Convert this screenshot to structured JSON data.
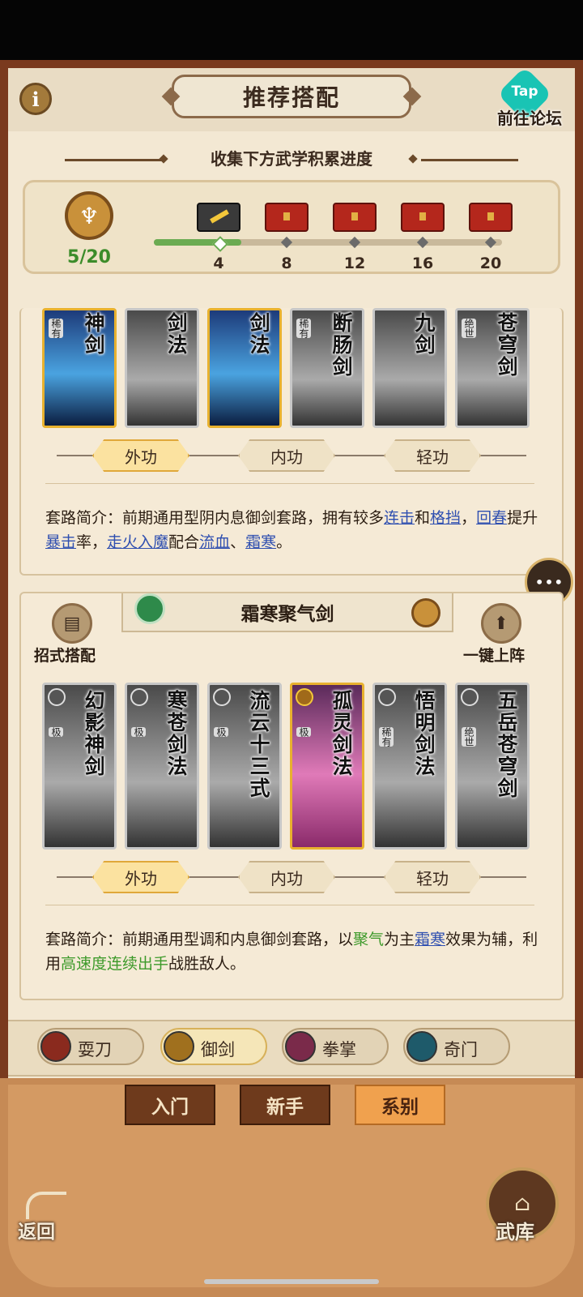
{
  "header": {
    "title": "推荐搭配",
    "info_icon": "i",
    "tap_logo": "Tap",
    "forum_label": "前往论坛"
  },
  "progress": {
    "title": "收集下方武学积累进度",
    "current": "5/20",
    "fraction": 0.25,
    "milestones": [
      {
        "value": "4",
        "state": "claimed"
      },
      {
        "value": "8",
        "state": "locked"
      },
      {
        "value": "12",
        "state": "locked"
      },
      {
        "value": "16",
        "state": "locked"
      },
      {
        "value": "20",
        "state": "locked"
      }
    ]
  },
  "set1": {
    "cards": [
      {
        "name": "神剑",
        "tag": "稀有",
        "style": "blue-gold"
      },
      {
        "name": "剑法",
        "tag": "",
        "style": "gray"
      },
      {
        "name": "剑法",
        "tag": "",
        "style": "blue-gold"
      },
      {
        "name": "断肠剑",
        "tag": "稀有",
        "style": "gray"
      },
      {
        "name": "九剑",
        "tag": "",
        "style": "gray"
      },
      {
        "name": "苍穹剑",
        "tag": "绝世",
        "style": "gray"
      }
    ],
    "tabs": [
      "外功",
      "内功",
      "轻功"
    ],
    "active_tab": "外功",
    "desc_parts": [
      {
        "t": "套路简介：前期通用型阴内息御剑套路，拥有较多",
        "c": "text"
      },
      {
        "t": "连击",
        "c": "hl"
      },
      {
        "t": "和",
        "c": "text"
      },
      {
        "t": "格挡",
        "c": "hl"
      },
      {
        "t": "，",
        "c": "text"
      },
      {
        "t": "回春",
        "c": "hl"
      },
      {
        "t": "提升",
        "c": "text"
      },
      {
        "t": "暴击",
        "c": "hl"
      },
      {
        "t": "率，",
        "c": "text"
      },
      {
        "t": "走火入魔",
        "c": "hl"
      },
      {
        "t": "配合",
        "c": "text"
      },
      {
        "t": "流血",
        "c": "hl"
      },
      {
        "t": "、",
        "c": "text"
      },
      {
        "t": "霜寒",
        "c": "hl"
      },
      {
        "t": "。",
        "c": "text"
      }
    ]
  },
  "set2": {
    "title": "霜寒聚气剑",
    "left_button": "招式搭配",
    "right_button": "一键上阵",
    "cards": [
      {
        "name": "幻影神剑",
        "tag": "极",
        "style": "gray"
      },
      {
        "name": "寒苍剑法",
        "tag": "极",
        "style": "gray"
      },
      {
        "name": "流云十三式",
        "tag": "极",
        "style": "gray"
      },
      {
        "name": "孤灵剑法",
        "tag": "极",
        "style": "pink-gold"
      },
      {
        "name": "悟明剑法",
        "tag": "稀有",
        "style": "gray"
      },
      {
        "name": "五岳苍穹剑",
        "tag": "绝世",
        "style": "gray"
      }
    ],
    "tabs": [
      "外功",
      "内功",
      "轻功"
    ],
    "active_tab": "外功",
    "desc_parts": [
      {
        "t": "套路简介：前期通用型调和内息御剑套路，以",
        "c": "text"
      },
      {
        "t": "聚气",
        "c": "green"
      },
      {
        "t": "为主",
        "c": "text"
      },
      {
        "t": "霜寒",
        "c": "hl"
      },
      {
        "t": "效果为辅，利用",
        "c": "text"
      },
      {
        "t": "高速度连续出手",
        "c": "green"
      },
      {
        "t": "战胜敌人。",
        "c": "text"
      }
    ]
  },
  "categories": [
    {
      "label": "耍刀",
      "icon": "blade-icon",
      "color": "#8a2a1e",
      "active": false
    },
    {
      "label": "御剑",
      "icon": "sword-icon",
      "color": "#a0701e",
      "active": true
    },
    {
      "label": "拳掌",
      "icon": "fist-icon",
      "color": "#7a2a4a",
      "active": false
    },
    {
      "label": "奇门",
      "icon": "fan-icon",
      "color": "#1e5a6a",
      "active": false
    }
  ],
  "bottom_tabs": [
    {
      "label": "入门",
      "active": false
    },
    {
      "label": "新手",
      "active": false
    },
    {
      "label": "系别",
      "active": true
    }
  ],
  "back_label": "返回",
  "armory_label": "武库"
}
